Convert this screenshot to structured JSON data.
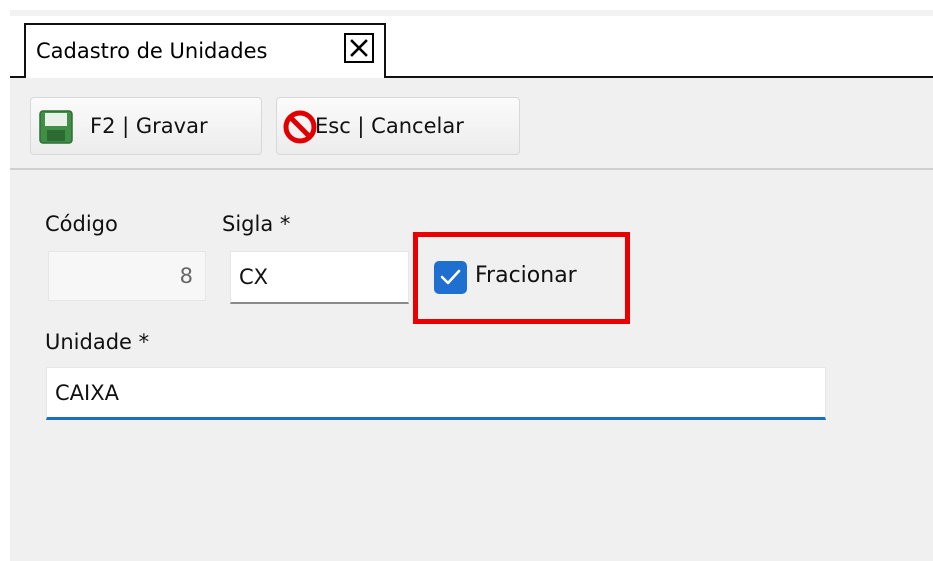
{
  "tab": {
    "label": "Cadastro de Unidades",
    "close_icon": "close-icon"
  },
  "toolbar": {
    "save_label": "F2 | Gravar",
    "save_icon": "floppy-disk-icon",
    "cancel_label": "Esc | Cancelar",
    "cancel_icon": "no-entry-icon"
  },
  "form": {
    "codigo": {
      "label": "Código",
      "value": "8"
    },
    "sigla": {
      "label": "Sigla *",
      "value": "CX"
    },
    "fracionar": {
      "label": "Fracionar",
      "checked": true
    },
    "unidade": {
      "label": "Unidade *",
      "value": "CAIXA"
    }
  },
  "colors": {
    "highlight": "#ea0000",
    "checkbox": "#1f6fd1",
    "focus_underline": "#1a6fbf"
  }
}
